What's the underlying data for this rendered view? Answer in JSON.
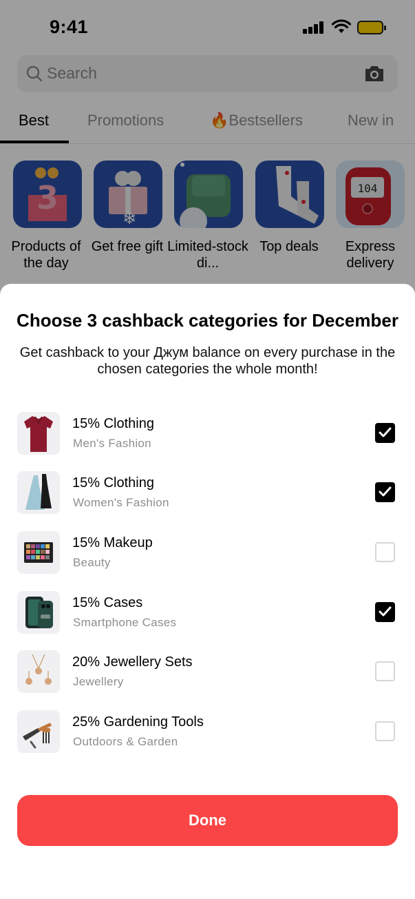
{
  "status_bar": {
    "time": "9:41"
  },
  "search": {
    "placeholder": "Search"
  },
  "tabs": [
    {
      "label": "Best",
      "active": true
    },
    {
      "label": "Promotions",
      "active": false
    },
    {
      "label": "🔥Bestsellers",
      "active": false
    },
    {
      "label": "New in",
      "active": false
    }
  ],
  "shortcuts": [
    {
      "label": "Products of the day"
    },
    {
      "label": "Get free gift"
    },
    {
      "label": "Limited-stock di..."
    },
    {
      "label": "Top deals"
    },
    {
      "label": "Express delivery"
    }
  ],
  "sheet": {
    "title": "Choose 3 cashback categories for December",
    "subtitle": "Get cashback to your Джум balance on every purchase in the chosen categories the whole month!",
    "items": [
      {
        "title": "15% Clothing",
        "subtitle": "Men's Fashion",
        "checked": true,
        "icon": "polo-shirt-icon"
      },
      {
        "title": "15% Clothing",
        "subtitle": "Women's Fashion",
        "checked": true,
        "icon": "dresses-icon"
      },
      {
        "title": "15% Makeup",
        "subtitle": "Beauty",
        "checked": false,
        "icon": "eyeshadow-palette-icon"
      },
      {
        "title": "15% Cases",
        "subtitle": "Smartphone Cases",
        "checked": true,
        "icon": "phone-case-icon"
      },
      {
        "title": "20% Jewellery Sets",
        "subtitle": "Jewellery",
        "checked": false,
        "icon": "jewellery-set-icon"
      },
      {
        "title": "25% Gardening Tools",
        "subtitle": "Outdoors & Garden",
        "checked": false,
        "icon": "garden-tools-icon"
      }
    ],
    "done_label": "Done"
  },
  "colors": {
    "accent": "#f94545",
    "tile_bg": "#2a4fa8",
    "checkbox_on": "#000000"
  }
}
